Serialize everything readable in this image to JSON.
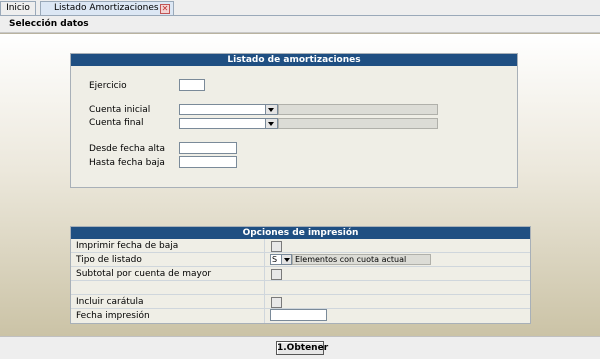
{
  "tabs": {
    "home_label": "Inicio",
    "active_label": "Listado Amortizaciones",
    "close_symbol": "✕"
  },
  "section": {
    "title": "Selección datos"
  },
  "panel_listado": {
    "title": "Listado de amortizaciones",
    "ejercicio_label": "Ejercicio",
    "ejercicio_value": "",
    "cuenta_inicial_label": "Cuenta inicial",
    "cuenta_inicial_value": "",
    "cuenta_final_label": "Cuenta final",
    "cuenta_final_value": "",
    "desde_fecha_alta_label": "Desde fecha alta",
    "desde_fecha_alta_value": "",
    "hasta_fecha_baja_label": "Hasta fecha baja",
    "hasta_fecha_baja_value": ""
  },
  "panel_opciones": {
    "title": "Opciones de impresión",
    "imprimir_fecha_baja_label": "Imprimir fecha de baja",
    "tipo_listado_label": "Tipo de listado",
    "tipo_listado_code": "S",
    "tipo_listado_desc": "Elementos con cuota actual",
    "subtotal_label": "Subtotal por cuenta de mayor",
    "incluir_caratula_label": "Incluir carátula",
    "fecha_impresion_label": "Fecha impresión",
    "fecha_impresion_value": ""
  },
  "actions": {
    "obtener_label": "1.Obtener"
  },
  "colors": {
    "panel_header": "#1f4f82",
    "tab_active": "#dce7f4"
  }
}
